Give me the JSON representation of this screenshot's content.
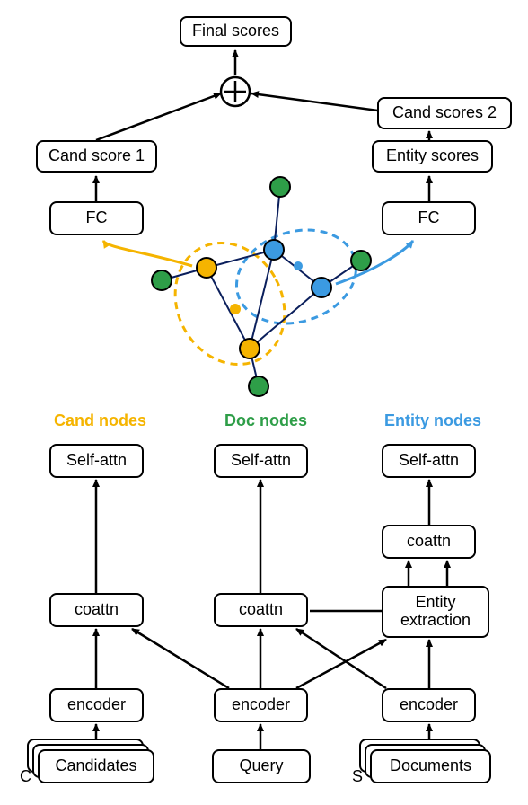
{
  "top": {
    "final_scores": "Final scores",
    "cand_score_1": "Cand score 1",
    "cand_scores_2": "Cand scores 2",
    "entity_scores": "Entity scores",
    "fc_left": "FC",
    "fc_right": "FC"
  },
  "labels": {
    "cand_nodes": "Cand nodes",
    "doc_nodes": "Doc nodes",
    "entity_nodes": "Entity nodes"
  },
  "left": {
    "self_attn": "Self-attn",
    "coattn": "coattn",
    "encoder": "encoder",
    "input": "Candidates",
    "stack_letter": "C"
  },
  "mid": {
    "self_attn": "Self-attn",
    "coattn": "coattn",
    "encoder": "encoder",
    "input": "Query"
  },
  "right": {
    "self_attn": "Self-attn",
    "coattn": "coattn",
    "entity_extraction": "Entity extraction",
    "encoder": "encoder",
    "input": "Documents",
    "stack_letter": "S"
  },
  "colors": {
    "cand": "#F5B400",
    "doc": "#2E9E48",
    "entity": "#3B9AE1"
  },
  "chart_data": {
    "type": "diagram",
    "title": "Multi-hop reading comprehension architecture with heterogeneous graph",
    "nodes": [
      {
        "id": "candidates_input",
        "label": "Candidates",
        "type": "input",
        "stacked": true
      },
      {
        "id": "query_input",
        "label": "Query",
        "type": "input"
      },
      {
        "id": "documents_input",
        "label": "Documents",
        "type": "input",
        "stacked": true
      },
      {
        "id": "enc_c",
        "label": "encoder",
        "type": "module"
      },
      {
        "id": "enc_q",
        "label": "encoder",
        "type": "module"
      },
      {
        "id": "enc_d",
        "label": "encoder",
        "type": "module"
      },
      {
        "id": "coattn_c",
        "label": "coattn",
        "type": "module"
      },
      {
        "id": "coattn_q",
        "label": "coattn",
        "type": "module"
      },
      {
        "id": "entity_extraction",
        "label": "Entity extraction",
        "type": "module"
      },
      {
        "id": "coattn_e",
        "label": "coattn",
        "type": "module"
      },
      {
        "id": "selfattn_c",
        "label": "Self-attn",
        "type": "module"
      },
      {
        "id": "selfattn_q",
        "label": "Self-attn",
        "type": "module"
      },
      {
        "id": "selfattn_e",
        "label": "Self-attn",
        "type": "module"
      },
      {
        "id": "graph",
        "label": "Heterogeneous graph (Cand / Doc / Entity nodes)",
        "type": "graph"
      },
      {
        "id": "fc_left",
        "label": "FC",
        "type": "module"
      },
      {
        "id": "fc_right",
        "label": "FC",
        "type": "module"
      },
      {
        "id": "cand_score_1",
        "label": "Cand score 1",
        "type": "output"
      },
      {
        "id": "entity_scores",
        "label": "Entity scores",
        "type": "output"
      },
      {
        "id": "cand_scores_2",
        "label": "Cand scores 2",
        "type": "output"
      },
      {
        "id": "sum",
        "label": "⊕",
        "type": "op"
      },
      {
        "id": "final_scores",
        "label": "Final scores",
        "type": "output"
      }
    ],
    "edges": [
      [
        "candidates_input",
        "enc_c"
      ],
      [
        "query_input",
        "enc_q"
      ],
      [
        "documents_input",
        "enc_d"
      ],
      [
        "enc_c",
        "coattn_c"
      ],
      [
        "enc_q",
        "coattn_c"
      ],
      [
        "enc_q",
        "coattn_q"
      ],
      [
        "enc_d",
        "coattn_q"
      ],
      [
        "enc_d",
        "entity_extraction"
      ],
      [
        "enc_q",
        "entity_extraction"
      ],
      [
        "entity_extraction",
        "coattn_e"
      ],
      [
        "coattn_q",
        "coattn_e"
      ],
      [
        "coattn_c",
        "selfattn_c"
      ],
      [
        "coattn_q",
        "selfattn_q"
      ],
      [
        "coattn_e",
        "selfattn_e"
      ],
      [
        "selfattn_c",
        "graph"
      ],
      [
        "selfattn_q",
        "graph"
      ],
      [
        "selfattn_e",
        "graph"
      ],
      [
        "graph",
        "fc_left"
      ],
      [
        "graph",
        "fc_right"
      ],
      [
        "fc_left",
        "cand_score_1"
      ],
      [
        "fc_right",
        "entity_scores"
      ],
      [
        "entity_scores",
        "cand_scores_2"
      ],
      [
        "cand_score_1",
        "sum"
      ],
      [
        "cand_scores_2",
        "sum"
      ],
      [
        "sum",
        "final_scores"
      ]
    ],
    "graph_node_types": [
      {
        "name": "Cand nodes",
        "color": "#F5B400",
        "count_visible": 3
      },
      {
        "name": "Doc nodes",
        "color": "#2E9E48",
        "count_visible": 4
      },
      {
        "name": "Entity nodes",
        "color": "#3B9AE1",
        "count_visible": 3
      }
    ]
  }
}
